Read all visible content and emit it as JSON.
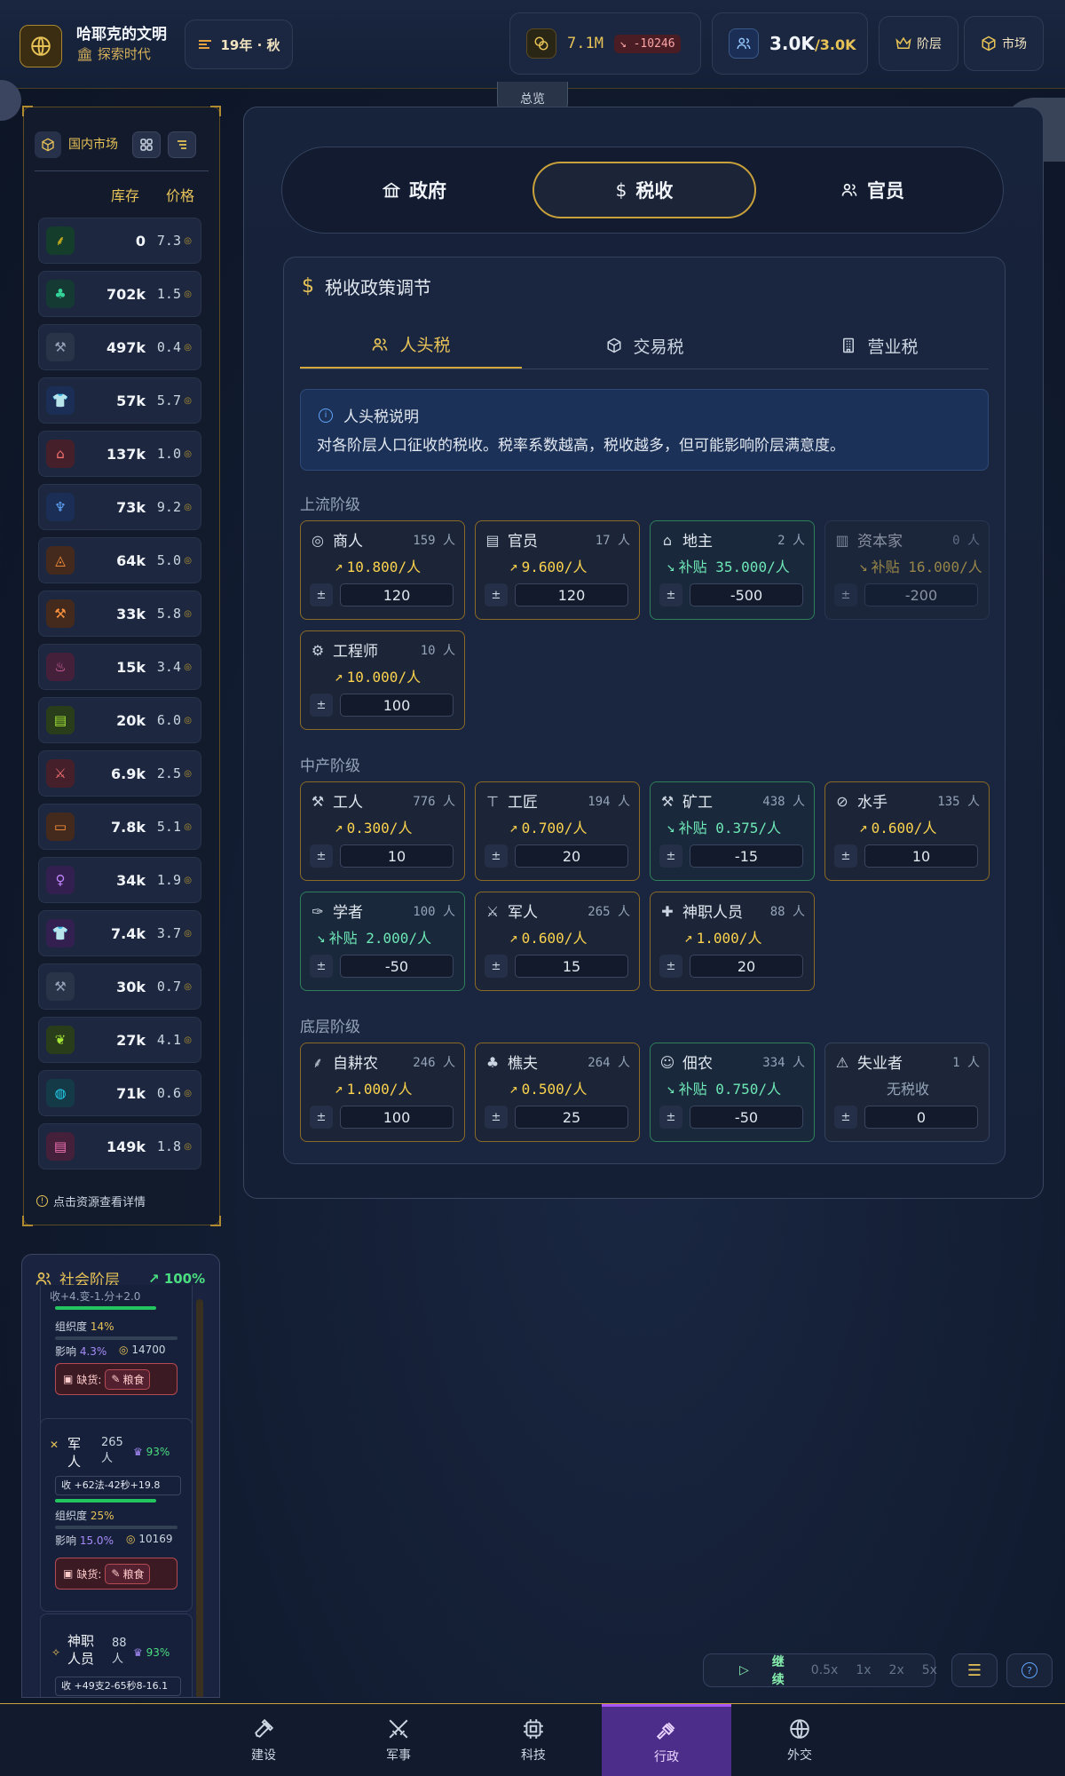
{
  "topbar": {
    "civ_name": "哈耶克的文明",
    "era": "探索时代",
    "date": "19年 · 秋",
    "gold": "7.1M",
    "gold_delta": "-10246",
    "pop": "3.0K",
    "pop_max": "/3.0K",
    "strata_btn": "阶层",
    "market_btn": "市场"
  },
  "overview_tab": "总览",
  "market": {
    "title": "国内市场",
    "col_stock": "库存",
    "col_price": "价格",
    "footer": "点击资源查看详情",
    "resources": [
      {
        "icon": "wheat-icon",
        "color": "#facc15",
        "bg": "#143d2c",
        "stock": "0",
        "price": "7.3"
      },
      {
        "icon": "tree-icon",
        "color": "#34d399",
        "bg": "#153a33",
        "stock": "702k",
        "price": "1.5"
      },
      {
        "icon": "pickaxe-icon",
        "color": "#94a3b8",
        "bg": "#2a3448",
        "stock": "497k",
        "price": "0.4"
      },
      {
        "icon": "shirt-icon",
        "color": "#60a5fa",
        "bg": "#1b2e55",
        "stock": "57k",
        "price": "5.7"
      },
      {
        "icon": "house-icon",
        "color": "#f87171",
        "bg": "#45202b",
        "stock": "137k",
        "price": "1.0"
      },
      {
        "icon": "goblet-icon",
        "color": "#60a5fa",
        "bg": "#1b2e55",
        "stock": "73k",
        "price": "9.2"
      },
      {
        "icon": "bell-icon",
        "color": "#fb923c",
        "bg": "#442a1d",
        "stock": "64k",
        "price": "5.0"
      },
      {
        "icon": "hammer-icon",
        "color": "#fb923c",
        "bg": "#442a1d",
        "stock": "33k",
        "price": "5.8"
      },
      {
        "icon": "flame-icon",
        "color": "#f472b6",
        "bg": "#44203a",
        "stock": "15k",
        "price": "3.4"
      },
      {
        "icon": "scroll-icon",
        "color": "#a3e635",
        "bg": "#2a3d1a",
        "stock": "20k",
        "price": "6.0"
      },
      {
        "icon": "crossed-swords-icon",
        "color": "#f87171",
        "bg": "#45202b",
        "stock": "6.9k",
        "price": "2.5"
      },
      {
        "icon": "car-icon",
        "color": "#fb923c",
        "bg": "#442a1d",
        "stock": "7.8k",
        "price": "5.1"
      },
      {
        "icon": "wine-icon",
        "color": "#c084fc",
        "bg": "#342050",
        "stock": "34k",
        "price": "1.9"
      },
      {
        "icon": "shirt-icon",
        "color": "#c084fc",
        "bg": "#342050",
        "stock": "7.4k",
        "price": "3.7"
      },
      {
        "icon": "pickaxe-icon",
        "color": "#94a3b8",
        "bg": "#2a3448",
        "stock": "30k",
        "price": "0.7"
      },
      {
        "icon": "leaf-icon",
        "color": "#a3e635",
        "bg": "#2a3d1a",
        "stock": "27k",
        "price": "4.1"
      },
      {
        "icon": "globe-icon",
        "color": "#22d3ee",
        "bg": "#143a48",
        "stock": "71k",
        "price": "0.6"
      },
      {
        "icon": "scroll-icon",
        "color": "#f472b6",
        "bg": "#44203a",
        "stock": "149k",
        "price": "1.8"
      }
    ]
  },
  "strata": {
    "title": "社会阶层",
    "pct": "100%",
    "top_card": {
      "partial": "收+4.变-1.分+2.0",
      "org_label": "组织度",
      "org": "14%",
      "inf_label": "影响",
      "inf": "4.3%",
      "wealth": "14700",
      "lack_label": "缺货:",
      "lack_item": "粮食"
    },
    "soldier": {
      "name": "军人",
      "count": "265 人",
      "happy": "93%",
      "income": "收 +62法-42秒+19.8",
      "org_label": "组织度",
      "org": "25%",
      "inf_label": "影响",
      "inf": "15.0%",
      "wealth": "10169",
      "lack_label": "缺货:",
      "lack_item": "粮食"
    },
    "cleric": {
      "name": "神职人员",
      "count": "88 人",
      "happy": "93%",
      "income": "收 +49支2-65秒8-16.1"
    }
  },
  "tabs": {
    "gov": "政府",
    "tax": "税收",
    "official": "官员"
  },
  "tax": {
    "title": "税收政策调节",
    "sub_head": "人头税",
    "sub_trade": "交易税",
    "sub_business": "营业税",
    "note_title": "人头税说明",
    "note_desc": "对各阶层人口征收的税收。税率系数越高，税收越多，但可能影响阶层满意度。",
    "group_upper": "上流阶级",
    "group_middle": "中产阶级",
    "group_lower": "底层阶级",
    "pm": "±",
    "upper": [
      {
        "name": "商人",
        "icon": "coins-icon",
        "count": "159 人",
        "rate": "10.800/人",
        "value": "120",
        "kind": "tax"
      },
      {
        "name": "官员",
        "icon": "scroll-icon",
        "count": "17 人",
        "rate": "9.600/人",
        "value": "120",
        "kind": "tax"
      },
      {
        "name": "地主",
        "icon": "store-icon",
        "count": "2 人",
        "rate": "补贴 35.000/人",
        "value": "-500",
        "kind": "sub"
      },
      {
        "name": "资本家",
        "icon": "factory-icon",
        "count": "0 人",
        "rate": "补贴 16.000/人",
        "value": "-200",
        "kind": "zero"
      },
      {
        "name": "工程师",
        "icon": "cog-icon",
        "count": "10 人",
        "rate": "10.000/人",
        "value": "100",
        "kind": "tax"
      }
    ],
    "middle": [
      {
        "name": "工人",
        "icon": "hammer-icon",
        "count": "776 人",
        "rate": "0.300/人",
        "value": "10",
        "kind": "tax"
      },
      {
        "name": "工匠",
        "icon": "anvil-icon",
        "count": "194 人",
        "rate": "0.700/人",
        "value": "20",
        "kind": "tax"
      },
      {
        "name": "矿工",
        "icon": "pickaxe-icon",
        "count": "438 人",
        "rate": "补贴 0.375/人",
        "value": "-15",
        "kind": "sub"
      },
      {
        "name": "水手",
        "icon": "compass-icon",
        "count": "135 人",
        "rate": "0.600/人",
        "value": "10",
        "kind": "tax"
      },
      {
        "name": "学者",
        "icon": "feather-icon",
        "count": "100 人",
        "rate": "补贴 2.000/人",
        "value": "-50",
        "kind": "sub"
      },
      {
        "name": "军人",
        "icon": "crossed-swords-icon",
        "count": "265 人",
        "rate": "0.600/人",
        "value": "15",
        "kind": "tax"
      },
      {
        "name": "神职人员",
        "icon": "cross-icon",
        "count": "88 人",
        "rate": "1.000/人",
        "value": "20",
        "kind": "tax"
      }
    ],
    "lower": [
      {
        "name": "自耕农",
        "icon": "wheat-icon",
        "count": "246 人",
        "rate": "1.000/人",
        "value": "100",
        "kind": "tax"
      },
      {
        "name": "樵夫",
        "icon": "tree-icon",
        "count": "264 人",
        "rate": "0.500/人",
        "value": "25",
        "kind": "tax"
      },
      {
        "name": "佃农",
        "icon": "users-icon",
        "count": "334 人",
        "rate": "补贴 0.750/人",
        "value": "-50",
        "kind": "sub"
      },
      {
        "name": "失业者",
        "icon": "warning-icon",
        "count": "1 人",
        "rate": "无税收",
        "value": "0",
        "kind": "none"
      }
    ]
  },
  "speed": {
    "play": "继续",
    "s05": "0.5x",
    "s1": "1x",
    "s2": "2x",
    "s5": "5x"
  },
  "nav": {
    "build": "建设",
    "military": "军事",
    "tech": "科技",
    "admin": "行政",
    "diplomacy": "外交"
  }
}
